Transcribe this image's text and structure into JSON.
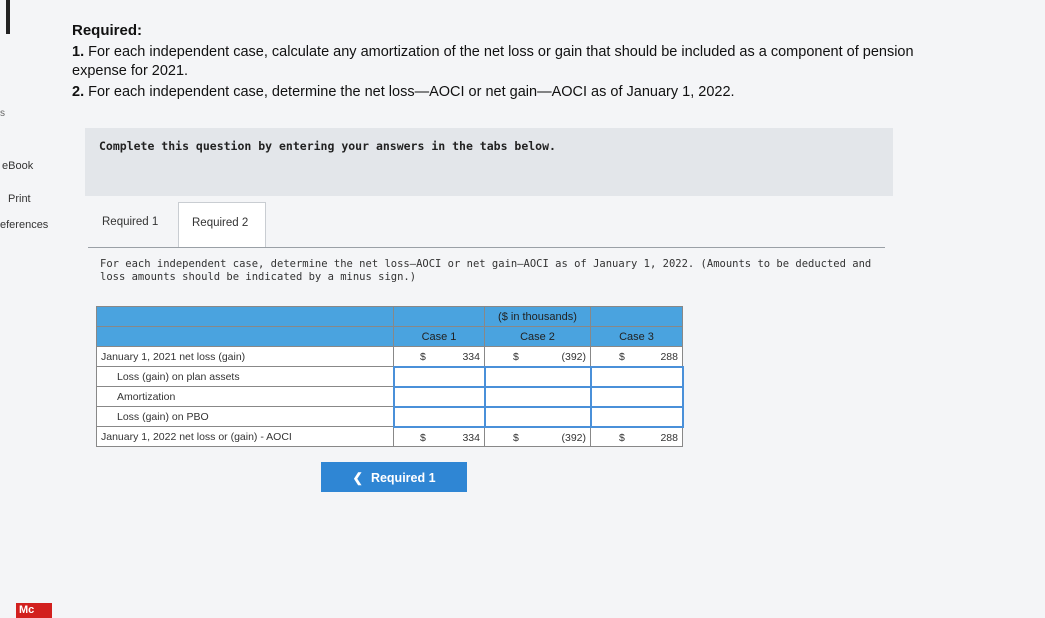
{
  "sidebar": {
    "fragment": "s",
    "ebook": "eBook",
    "print": "Print",
    "references": "eferences",
    "logo": "Mc"
  },
  "required": {
    "heading": "Required:",
    "item1_num": "1.",
    "item1_text": "For each independent case, calculate any amortization of the net loss or gain that should be included as a component of pension expense for 2021.",
    "item2_num": "2.",
    "item2_text": "For each independent case, determine the net loss—AOCI or net gain—AOCI as of January 1, 2022."
  },
  "instruction": "Complete this question by entering your answers in the tabs below.",
  "tabs": [
    {
      "label": "Required 1",
      "active": false
    },
    {
      "label": "Required 2",
      "active": true
    }
  ],
  "question": "For each independent case, determine the net loss—AOCI or net gain—AOCI as of January 1, 2022. (Amounts to be deducted and loss amounts should be indicated by a minus sign.)",
  "table": {
    "units_header": "($ in thousands)",
    "columns": [
      "Case 1",
      "Case 2",
      "Case 3"
    ],
    "rows": [
      {
        "label": "January 1, 2021 net loss (gain)",
        "values": [
          "334",
          "(392)",
          "288"
        ],
        "currency": "$"
      },
      {
        "label": "Loss (gain) on plan assets",
        "values": [
          "",
          "",
          ""
        ]
      },
      {
        "label": "Amortization",
        "values": [
          "",
          "",
          ""
        ]
      },
      {
        "label": "Loss (gain) on PBO",
        "values": [
          "",
          "",
          ""
        ]
      },
      {
        "label": "January 1, 2022 net loss or (gain) - AOCI",
        "values": [
          "334",
          "(392)",
          "288"
        ],
        "currency": "$"
      }
    ]
  },
  "nav_button": {
    "label": "Required 1",
    "icon": "chevron-left-icon"
  },
  "colors": {
    "accent": "#2f86d4",
    "header_blue": "#4aa3df",
    "instruction_bg": "#e3e6ea"
  }
}
